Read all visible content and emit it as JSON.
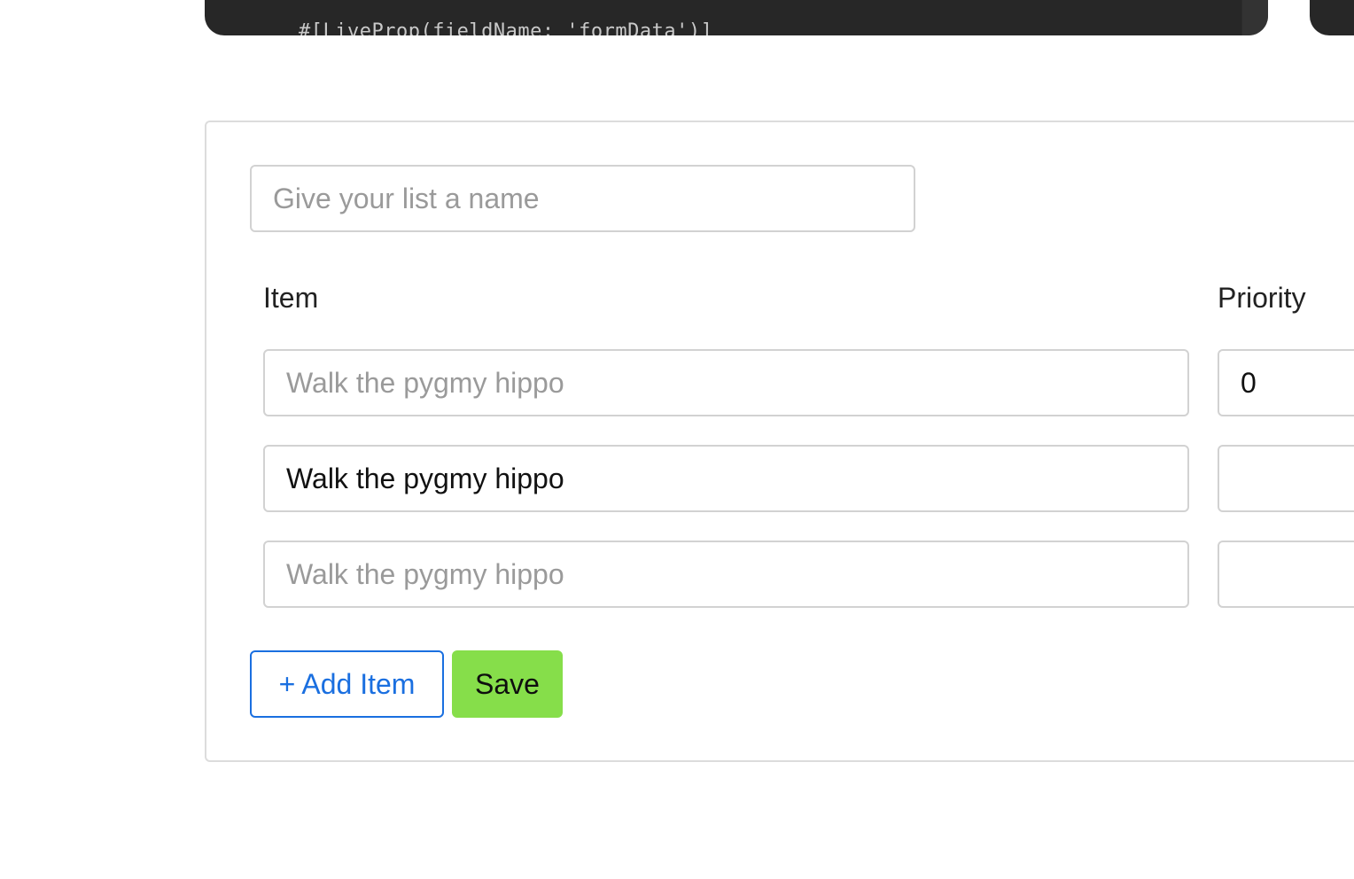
{
  "code": {
    "line": "#[LiveProp(fieldName: 'formData')]"
  },
  "form": {
    "list_name_placeholder": "Give your list a name",
    "list_name_value": "",
    "columns": {
      "item": "Item",
      "priority": "Priority"
    },
    "rows": [
      {
        "item_value": "",
        "item_placeholder": "Walk the pygmy hippo",
        "priority_value": "0"
      },
      {
        "item_value": "Walk the pygmy hippo",
        "item_placeholder": "Walk the pygmy hippo",
        "priority_value": ""
      },
      {
        "item_value": "",
        "item_placeholder": "Walk the pygmy hippo",
        "priority_value": ""
      }
    ],
    "add_item_label": "+ Add Item",
    "save_label": "Save"
  },
  "colors": {
    "accent": "#1a6fe0",
    "save": "#86de4a",
    "code_bg": "#272727"
  }
}
